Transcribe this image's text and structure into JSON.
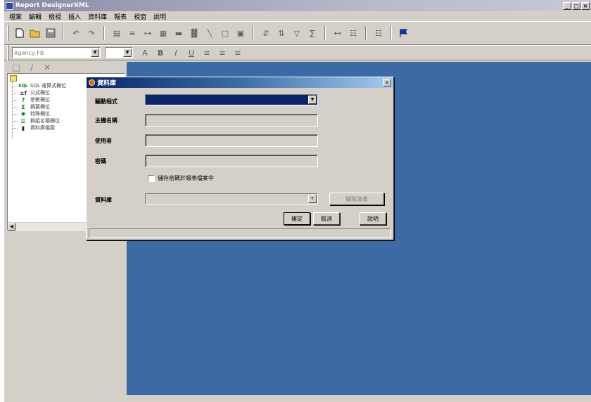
{
  "app": {
    "title": "Report DesignerXML",
    "window_buttons": [
      "_",
      "□",
      "×"
    ]
  },
  "menubar": {
    "items": [
      "檔案",
      "編輯",
      "檢視",
      "插入",
      "資料庫",
      "報表",
      "視窗",
      "說明"
    ]
  },
  "toolbar": {
    "font_name": "Agency FB",
    "font_size": "",
    "icons": [
      "new-icon",
      "open-icon",
      "save-icon",
      "undo-icon",
      "redo-icon",
      "page-icon",
      "insert-field-icon",
      "insert-group-icon",
      "insert-table-icon",
      "insert-bar-icon",
      "insert-chart-icon",
      "line-icon",
      "box-icon",
      "image-icon",
      "sort-asc-icon",
      "sort-desc-icon",
      "filter-icon",
      "formula-icon",
      "link-icon",
      "hierarchy-icon",
      "preview-icon",
      "flag-icon"
    ],
    "format_glyphs": {
      "font_color": "A",
      "bold": "B",
      "italic": "I",
      "underline": "U",
      "align_left": "≡",
      "align_center": "≡",
      "align_right": "≡"
    },
    "panel_glyphs": {
      "new_field": "□",
      "edit_field": "∕",
      "delete_field": "✕"
    }
  },
  "field_tree": {
    "items": [
      {
        "icon": "SQL",
        "label": "SQL 運算式欄位",
        "color": "#008000"
      },
      {
        "icon": "±f",
        "label": "公式欄位",
        "color": "#000000"
      },
      {
        "icon": "?",
        "label": "參數欄位",
        "color": "#008000"
      },
      {
        "icon": "Σ",
        "label": "摘要欄位",
        "color": "#008000"
      },
      {
        "icon": "✱",
        "label": "特殊欄位",
        "color": "#008000"
      },
      {
        "icon": "☰",
        "label": "群組名稱欄位",
        "color": "#008000"
      },
      {
        "icon": "▮",
        "label": "資料庫檔案",
        "color": "#004000"
      }
    ],
    "scroll_left": "◀"
  },
  "dialog": {
    "title": "資料庫",
    "close": "×",
    "labels": {
      "driver": "驅動程式",
      "host": "主機名稱",
      "user": "使用者",
      "password": "密碼",
      "database": "資料庫"
    },
    "driver_value": "",
    "host_value": "",
    "user_value": "",
    "password_value": "",
    "database_value": "",
    "save_password_label": "儲存密碼於報表檔案中",
    "save_password_checked": false,
    "list_tables_button": "擷取清單",
    "ok_button": "確定",
    "cancel_button": "取消",
    "help_button": "說明",
    "arrow": "▼"
  },
  "colors": {
    "workspace": "#3b6aa4",
    "dialog_title_start": "#0a246a",
    "face": "#d4d0c8"
  }
}
